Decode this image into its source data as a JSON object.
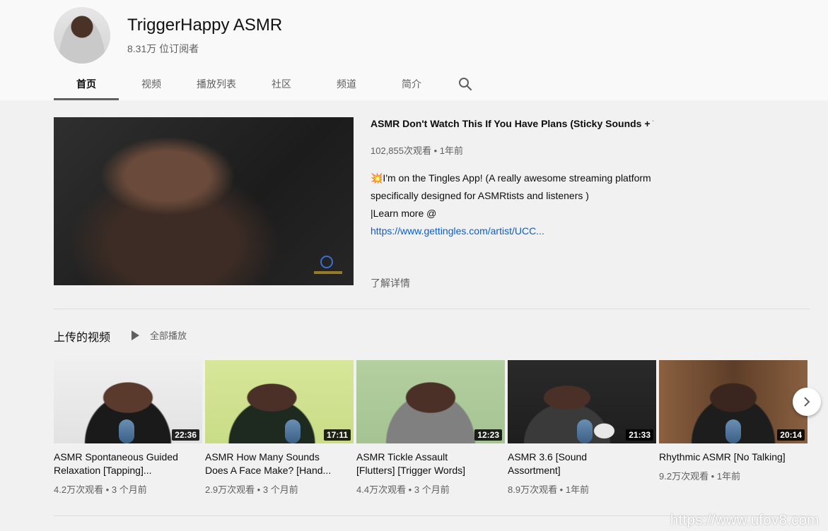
{
  "channel": {
    "name": "TriggerHappy ASMR",
    "subscribers": "8.31万 位订阅者"
  },
  "tabs": [
    {
      "label": "首页",
      "active": true
    },
    {
      "label": "视频"
    },
    {
      "label": "播放列表"
    },
    {
      "label": "社区"
    },
    {
      "label": "频道"
    },
    {
      "label": "简介"
    }
  ],
  "featured": {
    "title": "ASMR Don't Watch This If You Have Plans (Sticky Sounds + Ta...",
    "meta": "102,855次观看 • 1年前",
    "desc_line1": "💥I'm on the Tingles App! (A really awesome streaming platform",
    "desc_line2": "specifically designed for ASMRtists and listeners )",
    "desc_line3": "|Learn more @",
    "link": "https://www.gettingles.com/artist/UCC...",
    "more": "了解详情"
  },
  "shelf": {
    "title": "上传的视频",
    "play_all": "全部播放",
    "videos": [
      {
        "title1": "ASMR Spontaneous Guided",
        "title2": "Relaxation [Tapping]...",
        "meta": "4.2万次观看 • 3 个月前",
        "duration": "22:36"
      },
      {
        "title1": "ASMR How Many Sounds",
        "title2": "Does A Face Make? [Hand...",
        "meta": "2.9万次观看 • 3 个月前",
        "duration": "17:11"
      },
      {
        "title1": "ASMR Tickle Assault",
        "title2": "[Flutters] [Trigger Words]",
        "meta": "4.4万次观看 • 3 个月前",
        "duration": "12:23"
      },
      {
        "title1": "ASMR 3.6 [Sound",
        "title2": "Assortment]",
        "meta": "8.9万次观看 • 1年前",
        "duration": "21:33"
      },
      {
        "title1": "Rhythmic ASMR [No Talking]",
        "title2": "",
        "meta": "9.2万次观看 • 1年前",
        "duration": "20:14"
      }
    ]
  },
  "watermark": "https://www.ufov8.com",
  "colors": {
    "link": "#065fd4",
    "background": "#f1f1f1",
    "header_bg": "#f9f9f9"
  },
  "icons": {
    "search": "search-icon",
    "next": "chevron-right-icon",
    "play": "play-icon"
  }
}
